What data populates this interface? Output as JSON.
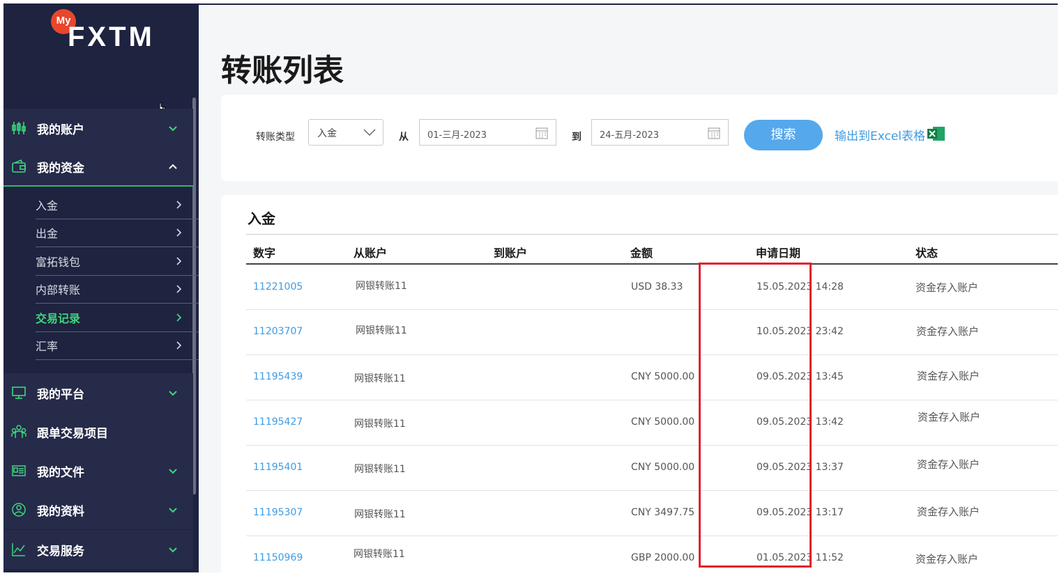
{
  "logo": {
    "badge": "My",
    "brand": "FXTM"
  },
  "nav": [
    {
      "label": "我的账户",
      "icon": "candlestick-icon",
      "expanded": false
    },
    {
      "label": "我的资金",
      "icon": "wallet-icon",
      "expanded": true
    },
    {
      "label": "我的平台",
      "icon": "monitor-icon",
      "expanded": false
    },
    {
      "label": "跟单交易项目",
      "icon": "people-icon",
      "expanded": false
    },
    {
      "label": "我的文件",
      "icon": "document-icon",
      "expanded": false
    },
    {
      "label": "我的资料",
      "icon": "user-circle-icon",
      "expanded": false
    },
    {
      "label": "交易服务",
      "icon": "chart-line-icon",
      "expanded": false
    }
  ],
  "funds_submenu": [
    {
      "label": "入金"
    },
    {
      "label": "出金"
    },
    {
      "label": "富拓钱包"
    },
    {
      "label": "内部转账"
    },
    {
      "label": "交易记录",
      "current": true
    },
    {
      "label": "汇率"
    }
  ],
  "page": {
    "title": "转账列表"
  },
  "filters": {
    "type_label": "转账类型",
    "type_value": "入金",
    "from_label": "从",
    "from_date": "01-三月-2023",
    "to_label": "到",
    "to_date": "24-五月-2023",
    "search_label": "搜索",
    "export_label": "输出到Excel表格"
  },
  "table": {
    "section_title": "入金",
    "columns": [
      "数字",
      "从账户",
      "到账户",
      "金额",
      "申请日期",
      "状态"
    ],
    "rows": [
      {
        "number": "11221005",
        "from": "网银转账11",
        "to": "",
        "amount": "USD 38.33",
        "date": "15.05.2023 14:28",
        "status": "资金存入账户"
      },
      {
        "number": "11203707",
        "from": "网银转账11",
        "to": "",
        "amount": "",
        "date": "10.05.2023 23:42",
        "status": "资金存入账户"
      },
      {
        "number": "11195439",
        "from": "网银转账11",
        "to": "",
        "amount": "CNY 5000.00",
        "date": "09.05.2023 13:45",
        "status": "资金存入账户"
      },
      {
        "number": "11195427",
        "from": "网银转账11",
        "to": "",
        "amount": "CNY 5000.00",
        "date": "09.05.2023 13:42",
        "status": "资金存入账户"
      },
      {
        "number": "11195401",
        "from": "网银转账11",
        "to": "",
        "amount": "CNY 5000.00",
        "date": "09.05.2023 13:37",
        "status": "资金存入账户"
      },
      {
        "number": "11195307",
        "from": "网银转账11",
        "to": "",
        "amount": "CNY 3497.75",
        "date": "09.05.2023 13:17",
        "status": "资金存入账户"
      },
      {
        "number": "11150969",
        "from": "网银转账11",
        "to": "",
        "amount": "GBP 2000.00",
        "date": "01.05.2023 11:52",
        "status": "资金存入账户"
      }
    ]
  },
  "colors": {
    "sidebar": "#1e2340",
    "accent_green": "#3dd87c",
    "link_blue": "#3d9be3",
    "button_blue": "#55a8ec",
    "highlight_red": "#e0202a"
  }
}
